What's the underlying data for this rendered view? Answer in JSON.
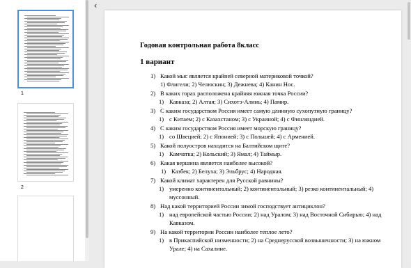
{
  "sidebar": {
    "pages": [
      {
        "label": "1",
        "selected": true
      },
      {
        "label": "2",
        "selected": false
      },
      {
        "label": "",
        "selected": false
      }
    ]
  },
  "toolbar": {
    "collapse_icon": "chevron-left-icon",
    "collapse_glyph": "‹"
  },
  "document": {
    "title": "Годовая контрольная работа 8класс",
    "variant": "1 вариант",
    "questions": [
      {
        "num": "1)",
        "text": "Какой мыс является крайней северной материковой точкой?",
        "answer_num": "",
        "answer": "1) Флигели; 2) Челюскин; 3) Дежнева; 4) Канин Нос."
      },
      {
        "num": "2)",
        "text": "В каких горах расположена крайняя южная точка России?",
        "answer_num": "1)",
        "answer": "Кавказа; 2) Алтая; 3) Сихотэ-Алинь; 4) Памир."
      },
      {
        "num": "3)",
        "text": "С каким государством Россия имеет самую длинную сухопутную границу?",
        "answer_num": "1)",
        "answer": "с Китаем; 2) с Казахстаном; 3) с Украиной; 4) с Финляндией."
      },
      {
        "num": "4)",
        "text": "С каким государством Россия имеет морскую границу?",
        "answer_num": "1)",
        "answer": "со Швецией; 2) с Японией; 3) с Польшей; 4) с Арменией."
      },
      {
        "num": "5)",
        "text": "Какой полуостров находится на Балтийском щите?",
        "answer_num": "1)",
        "answer": "Камчатка; 2) Кольский; 3) Ямал; 4) Таймыр."
      },
      {
        "num": "6)",
        "text": "Какая вершина является наиболее высокой?",
        "answer_num": "1)",
        "answer": "Казбек; 2) Белуха; 3) Эльбрус; 4) Народная."
      },
      {
        "num": "7)",
        "text": "Какой климат характерен для Русской равнины?",
        "answer_num": "1)",
        "answer": "умеренно континентальный; 2) континентальный; 3) резко континентальный; 4) муссонный."
      },
      {
        "num": "8)",
        "text": "Над какой территорией России зимой господствует антициклон?",
        "answer_num": "1)",
        "answer": "над европейской частью России; 2) над Уралом; 3) над Восточной Сибирью; 4) над Кавказом."
      },
      {
        "num": "9)",
        "text": "На какой территории России наиболее теплое лето?",
        "answer_num": "1)",
        "answer": "в Прикаспийской низменности; 2) на Среднерусской возвышенности; 3) на южном Урале; 4) на Сахалине."
      }
    ]
  }
}
